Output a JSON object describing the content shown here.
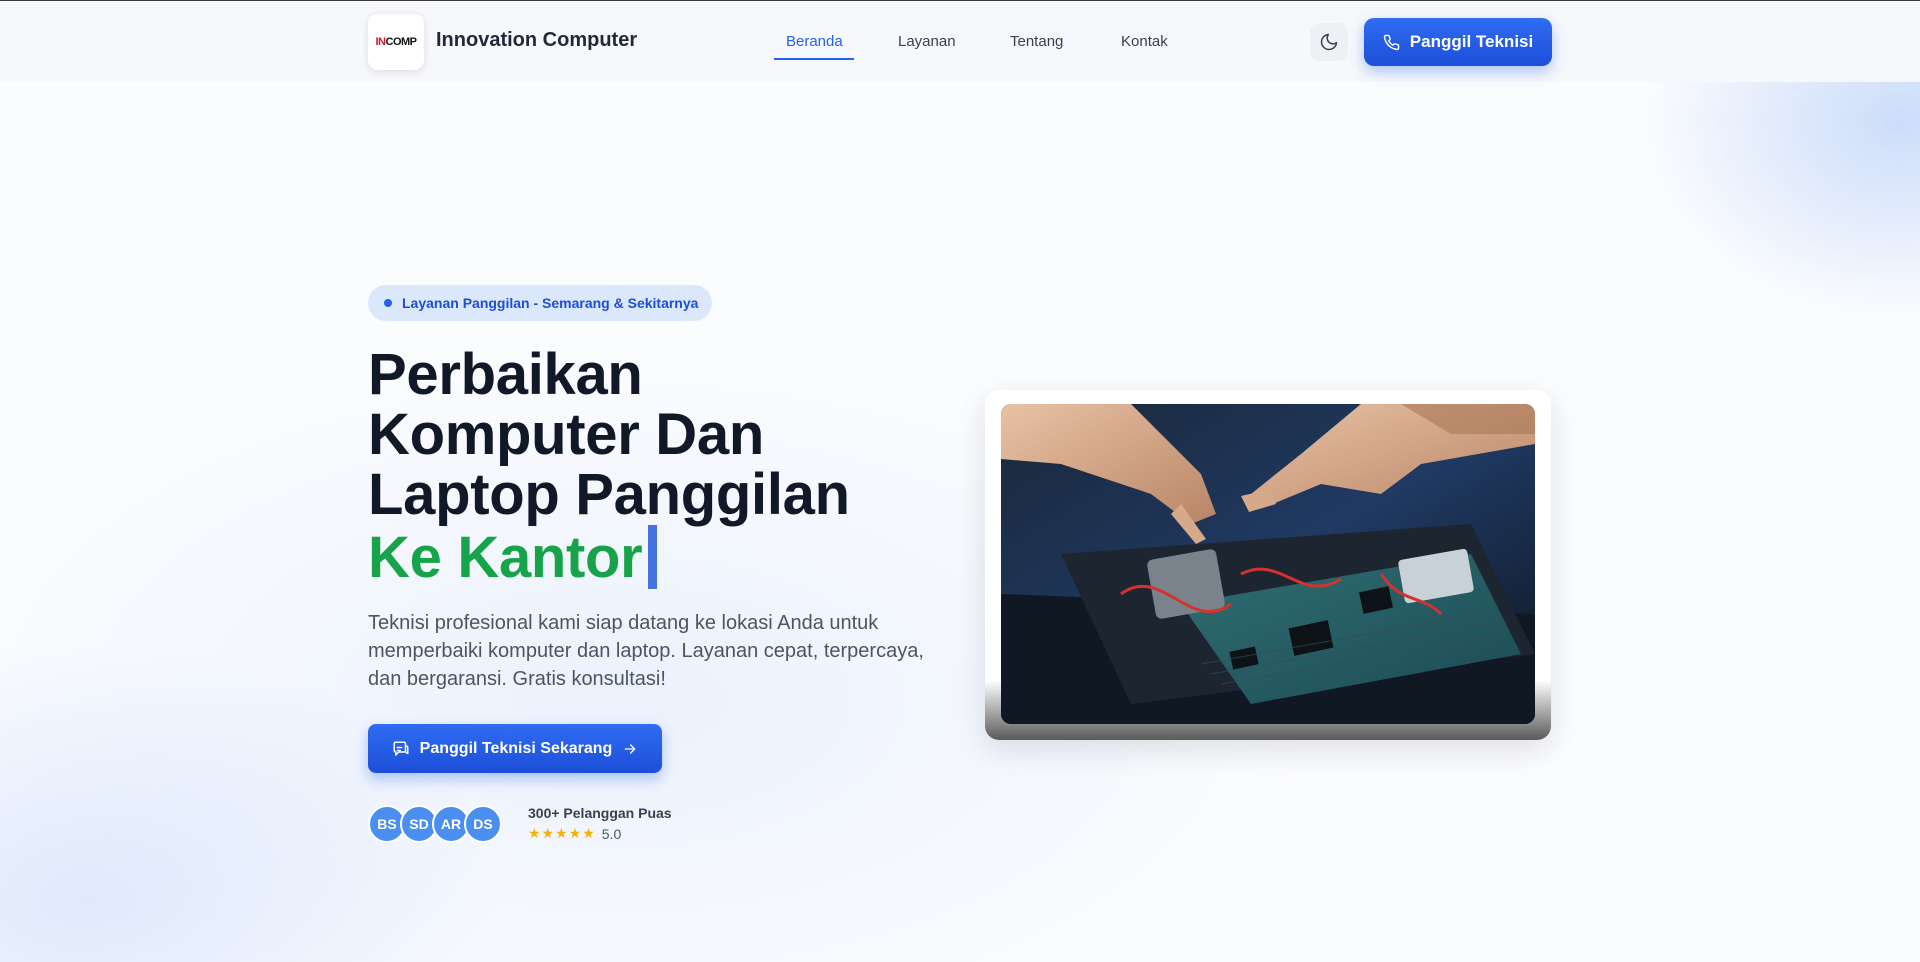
{
  "header": {
    "logo_text_prefix": "IN",
    "logo_text_suffix": "COMP",
    "brand": "Innovation Computer",
    "nav": [
      "Beranda",
      "Layanan",
      "Tentang",
      "Kontak"
    ],
    "active_nav": "Beranda",
    "cta_label": "Panggil Teknisi",
    "theme_icon": "moon-icon",
    "cta_icon": "phone-icon"
  },
  "hero": {
    "badge": "Layanan Panggilan - Semarang & Sekitarnya",
    "headline_lines": [
      "Perbaikan",
      "Komputer Dan",
      "Laptop Panggilan"
    ],
    "headline_highlight": "Ke Kantor",
    "subtext": "Teknisi profesional kami siap datang ke lokasi Anda untuk memperbaiki komputer dan laptop. Layanan cepat, terpercaya, dan bergaransi. Gratis konsultasi!",
    "cta_label": "Panggil Teknisi Sekarang",
    "cta_icon": "chat-icon",
    "cta_arrow_icon": "arrow-right-icon",
    "avatars": [
      "BS",
      "SD",
      "AR",
      "DS"
    ],
    "social_title": "300+ Pelanggan Puas",
    "rating_stars": 5,
    "rating_value": "5.0",
    "star_icon": "★★★★★"
  },
  "colors": {
    "primary": "#2563eb",
    "highlight": "#16a34a",
    "star": "#f5b301"
  }
}
